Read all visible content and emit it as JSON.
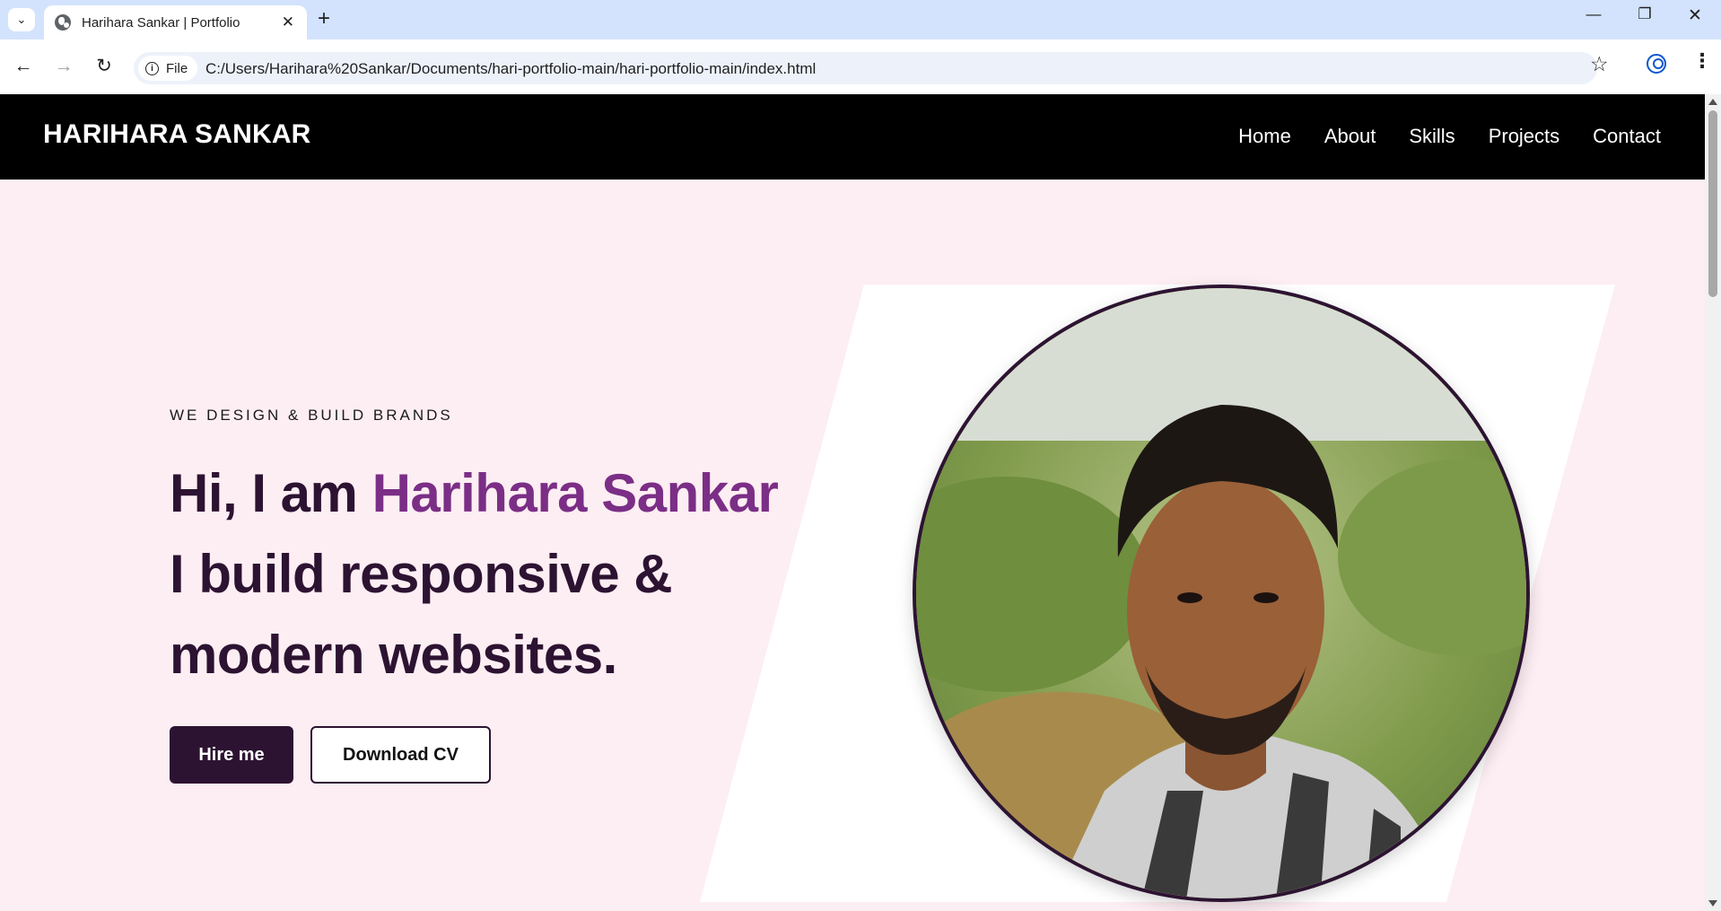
{
  "browser": {
    "tab_title": "Harihara Sankar | Portfolio",
    "url": "C:/Users/Harihara%20Sankar/Documents/hari-portfolio-main/hari-portfolio-main/index.html",
    "site_chip": "File",
    "icons": {
      "tab_search": "chevron-down-icon",
      "favicon": "globe-icon",
      "close": "close-icon",
      "new_tab": "plus-icon",
      "back": "arrow-left-icon",
      "forward": "arrow-right-icon",
      "reload": "reload-icon",
      "info": "info-icon",
      "bookmark": "star-icon",
      "profile": "profile-icon",
      "menu": "kebab-menu-icon"
    }
  },
  "site": {
    "brand": "HARIHARA SANKAR",
    "nav": [
      {
        "label": "Home"
      },
      {
        "label": "About"
      },
      {
        "label": "Skills"
      },
      {
        "label": "Projects"
      },
      {
        "label": "Contact"
      }
    ],
    "hero": {
      "eyebrow": "WE DESIGN & BUILD BRANDS",
      "line1_prefix": "Hi, I am ",
      "line1_name": "Harihara Sankar",
      "line2": "I build responsive &",
      "line3": "modern websites.",
      "hire_button": "Hire me",
      "cv_button": "Download CV"
    },
    "colors": {
      "background": "#fdeef3",
      "navbar": "#000000",
      "heading": "#2d1332",
      "accent": "#7b2e86",
      "panel": "#ffffff"
    }
  }
}
